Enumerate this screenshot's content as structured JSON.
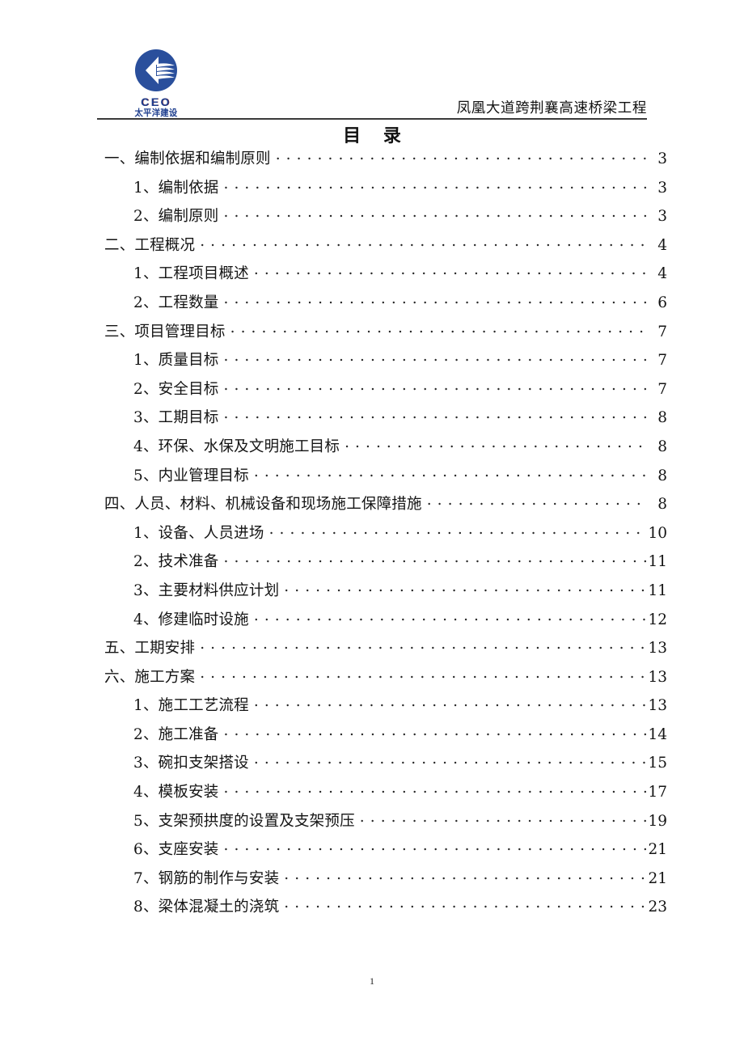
{
  "header": {
    "logo": {
      "mark_name": "pacific-construction-logo",
      "brand_latin": "CEO",
      "brand_chinese": "太平洋建设",
      "circle_color": "#2a4f9c",
      "accent_color": "#9c2020"
    },
    "document_title": "凤凰大道跨荆襄高速桥梁工程"
  },
  "toc": {
    "title": "目  录",
    "entries": [
      {
        "level": 1,
        "label": "一、编制依据和编制原则",
        "page": "3"
      },
      {
        "level": 2,
        "label": "1、编制依据",
        "page": "3"
      },
      {
        "level": 2,
        "label": "2、编制原则",
        "page": "3"
      },
      {
        "level": 1,
        "label": "二、工程概况",
        "page": "4"
      },
      {
        "level": 2,
        "label": "1、工程项目概述",
        "page": "4"
      },
      {
        "level": 2,
        "label": "2、工程数量",
        "page": "6"
      },
      {
        "level": 1,
        "label": "三、项目管理目标",
        "page": "7"
      },
      {
        "level": 2,
        "label": "1、质量目标",
        "page": "7"
      },
      {
        "level": 2,
        "label": "2、安全目标",
        "page": "7"
      },
      {
        "level": 2,
        "label": "3、工期目标",
        "page": "8"
      },
      {
        "level": 2,
        "label": "4、环保、水保及文明施工目标",
        "page": "8"
      },
      {
        "level": 2,
        "label": "5、内业管理目标",
        "page": "8"
      },
      {
        "level": 1,
        "label": "四、人员、材料、机械设备和现场施工保障措施",
        "page": "8"
      },
      {
        "level": 2,
        "label": "1、设备、人员进场",
        "page": "10"
      },
      {
        "level": 2,
        "label": "2、技术准备",
        "page": "11"
      },
      {
        "level": 2,
        "label": "3、主要材料供应计划",
        "page": "11"
      },
      {
        "level": 2,
        "label": "4、修建临时设施",
        "page": "12"
      },
      {
        "level": 1,
        "label": "五、工期安排",
        "page": "13"
      },
      {
        "level": 1,
        "label": "六、施工方案",
        "page": "13"
      },
      {
        "level": 2,
        "label": "1、施工工艺流程",
        "page": "13"
      },
      {
        "level": 2,
        "label": "2、施工准备",
        "page": "14"
      },
      {
        "level": 2,
        "label": "3、碗扣支架搭设",
        "page": "15"
      },
      {
        "level": 2,
        "label": "4、模板安装",
        "page": "17"
      },
      {
        "level": 2,
        "label": "5、支架预拱度的设置及支架预压",
        "page": "19"
      },
      {
        "level": 2,
        "label": "6、支座安装",
        "page": "21"
      },
      {
        "level": 2,
        "label": "7、钢筋的制作与安装",
        "page": "21"
      },
      {
        "level": 2,
        "label": "8、梁体混凝土的浇筑",
        "page": "23"
      }
    ]
  },
  "footer": {
    "page_number": "1"
  }
}
